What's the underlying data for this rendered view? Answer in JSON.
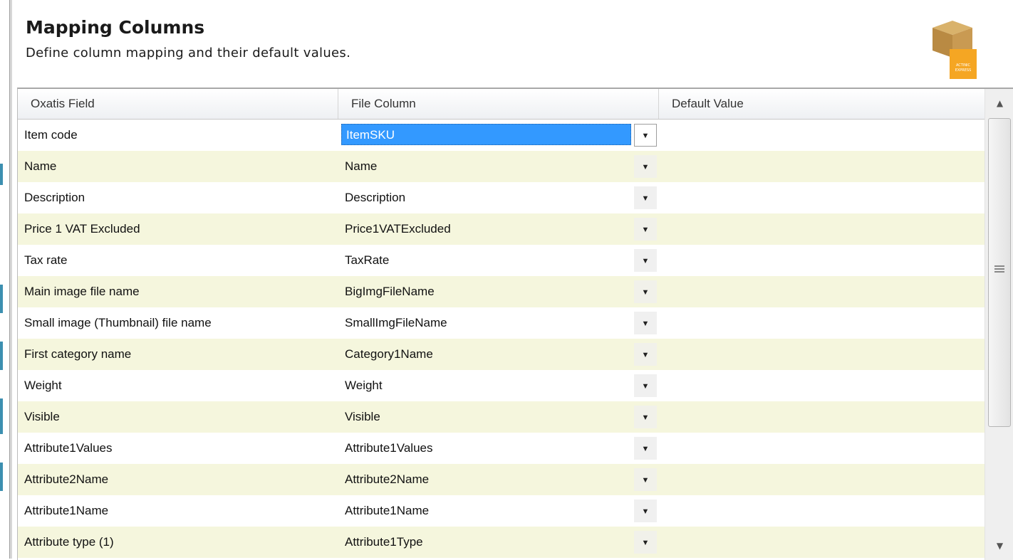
{
  "header": {
    "title": "Mapping Columns",
    "description": "Define column mapping and their default values."
  },
  "logo": {
    "text": "ACTINIC EXPRESS"
  },
  "grid": {
    "columns": [
      "Oxatis Field",
      "File Column",
      "Default Value"
    ],
    "rows": [
      {
        "field": "Item code",
        "file_column": "ItemSKU",
        "default_value": ""
      },
      {
        "field": "Name",
        "file_column": "Name",
        "default_value": ""
      },
      {
        "field": "Description",
        "file_column": "Description",
        "default_value": ""
      },
      {
        "field": "Price 1 VAT Excluded",
        "file_column": "Price1VATExcluded",
        "default_value": ""
      },
      {
        "field": "Tax rate",
        "file_column": "TaxRate",
        "default_value": ""
      },
      {
        "field": "Main image file name",
        "file_column": "BigImgFileName",
        "default_value": ""
      },
      {
        "field": "Small image (Thumbnail) file name",
        "file_column": "SmallImgFileName",
        "default_value": ""
      },
      {
        "field": "First category name",
        "file_column": "Category1Name",
        "default_value": ""
      },
      {
        "field": "Weight",
        "file_column": "Weight",
        "default_value": ""
      },
      {
        "field": "Visible",
        "file_column": "Visible",
        "default_value": ""
      },
      {
        "field": "Attribute1Values",
        "file_column": "Attribute1Values",
        "default_value": ""
      },
      {
        "field": "Attribute2Name",
        "file_column": "Attribute2Name",
        "default_value": ""
      },
      {
        "field": "Attribute1Name",
        "file_column": "Attribute1Name",
        "default_value": ""
      },
      {
        "field": "Attribute type (1)",
        "file_column": "Attribute1Type",
        "default_value": ""
      }
    ]
  },
  "icons": {
    "dropdown": "chevron-down-icon",
    "scroll_up": "scroll-up-icon",
    "scroll_down": "scroll-down-icon"
  },
  "colors": {
    "alt_row": "#f5f6dd",
    "selection": "#3399ff",
    "logo_badge": "#f5a623"
  }
}
